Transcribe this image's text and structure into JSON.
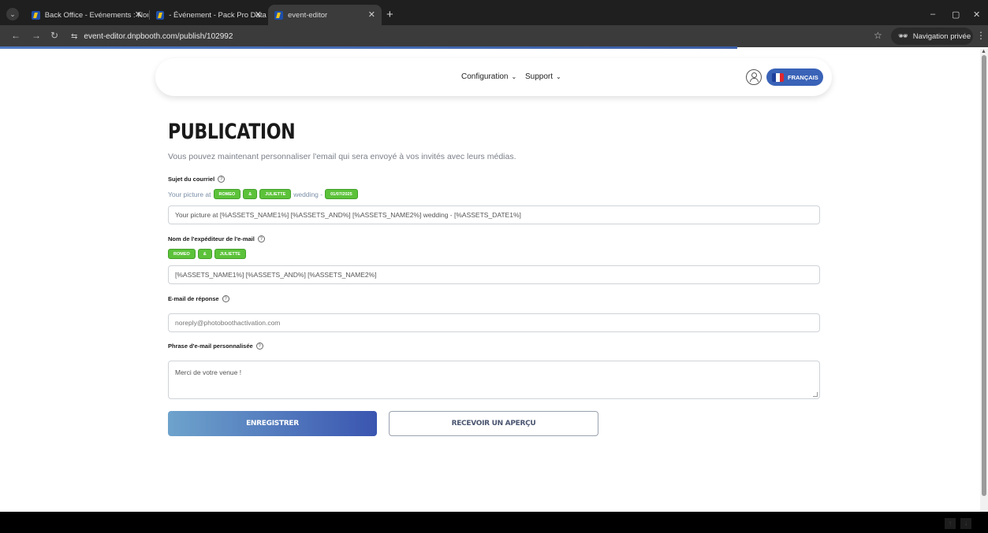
{
  "browser": {
    "tabs": [
      {
        "title": "Back Office - Evénements : Nou"
      },
      {
        "title": "- Événement - Pack Pro Data (E"
      },
      {
        "title": "event-editor"
      }
    ],
    "new_tab": "+",
    "url": "event-editor.dnpbooth.com/publish/102992",
    "private_label": "Navigation privée",
    "window_controls": {
      "minimize": "–",
      "restore": "▢",
      "close": "✕"
    }
  },
  "header": {
    "menu": [
      {
        "label": "Configuration"
      },
      {
        "label": "Support"
      }
    ],
    "language": "FRANÇAIS",
    "flag_colors": [
      "#1f3f9c",
      "#ffffff",
      "#e1262d"
    ]
  },
  "main": {
    "title": "PUBLICATION",
    "intro": "Vous pouvez maintenant personnaliser l'email qui sera envoyé à vos invités avec leurs médias.",
    "subject": {
      "label": "Sujet du courriel",
      "preview_prefix": "Your picture at",
      "chips": [
        "ROMEO",
        "&",
        "JULIETTE"
      ],
      "preview_middle": "wedding -",
      "date_chip": "01/07/2025",
      "value": "Your picture at [%ASSETS_NAME1%] [%ASSETS_AND%] [%ASSETS_NAME2%] wedding - [%ASSETS_DATE1%]"
    },
    "sender": {
      "label": "Nom de l'expéditeur de l'e-mail",
      "chips": [
        "ROMEO",
        "&",
        "JULIETTE"
      ],
      "value": "[%ASSETS_NAME1%] [%ASSETS_AND%] [%ASSETS_NAME2%]"
    },
    "reply": {
      "label": "E-mail de réponse",
      "placeholder": "noreply@photoboothactivation.com"
    },
    "phrase": {
      "label": "Phrase d'e-mail personnalisée",
      "value": "Merci de votre venue !"
    },
    "buttons": {
      "save": "ENREGISTRER",
      "preview": "RECEVOIR UN APERÇU"
    },
    "chip_color": "#5cc23a",
    "accent": "#3a63b8"
  }
}
